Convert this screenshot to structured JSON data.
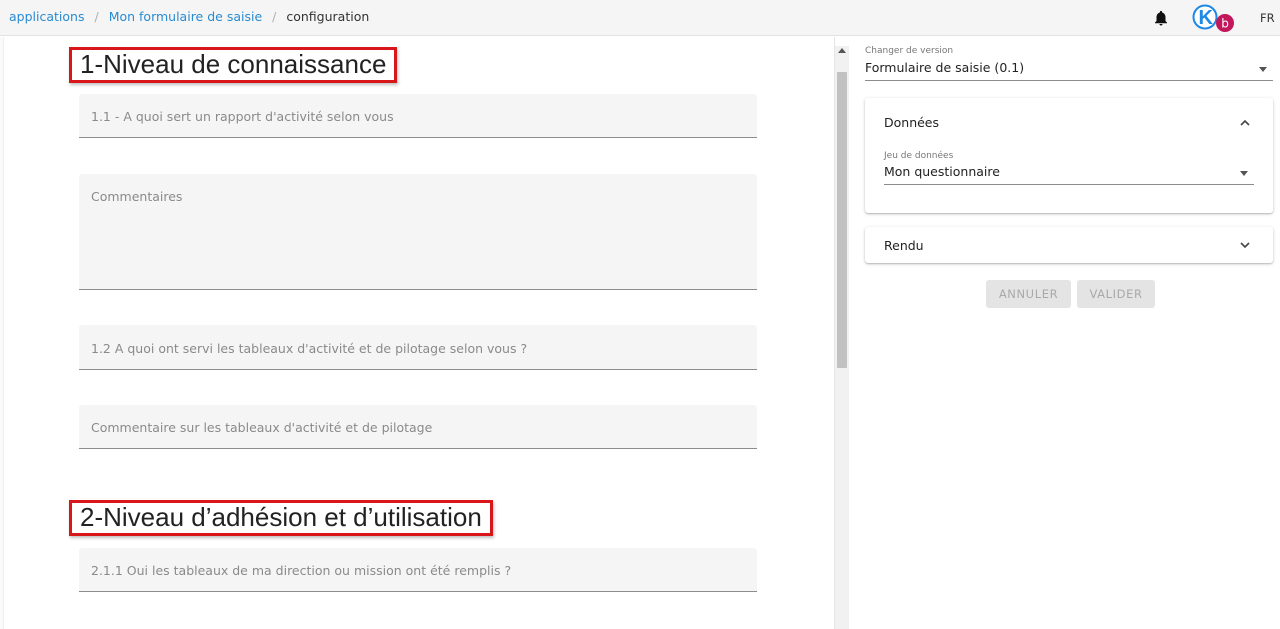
{
  "breadcrumb": {
    "items": [
      "applications",
      "Mon formulaire de saisie"
    ],
    "current": "configuration",
    "separator": "/"
  },
  "header": {
    "language": "FR",
    "avatar_letter": "b",
    "logo_letter": "K"
  },
  "form": {
    "sections": [
      {
        "title": "1-Niveau de connaissance"
      },
      {
        "title": "2-Niveau d’adhésion et d’utilisation"
      }
    ],
    "fields": [
      {
        "placeholder": "1.1 - A quoi sert un rapport d'activité selon vous"
      },
      {
        "placeholder": "Commentaires"
      },
      {
        "placeholder": "1.2 A quoi ont servi les tableaux d'activité et de pilotage selon vous ?"
      },
      {
        "placeholder": "Commentaire sur les tableaux d'activité et de pilotage"
      },
      {
        "placeholder": "2.1.1 Oui les tableaux de ma direction ou mission ont été remplis ?"
      }
    ]
  },
  "panel": {
    "version_label": "Changer de version",
    "version_value": "Formulaire de saisie (0.1)",
    "data_card": {
      "title": "Données",
      "dataset_label": "Jeu de données",
      "dataset_value": "Mon questionnaire"
    },
    "render_card": {
      "title": "Rendu"
    },
    "buttons": {
      "cancel": "ANNULER",
      "validate": "VALIDER"
    }
  },
  "colors": {
    "link": "#2a8bd1",
    "highlight_border": "#d9161a",
    "logo_blue": "#1e88e5",
    "avatar": "#c2185b"
  },
  "icons": {
    "notifications": "bell-icon",
    "scroll_up": "arrow-up-icon",
    "dropdown": "caret-down-icon",
    "expand": "chevron-down-icon",
    "collapse": "chevron-up-icon"
  }
}
